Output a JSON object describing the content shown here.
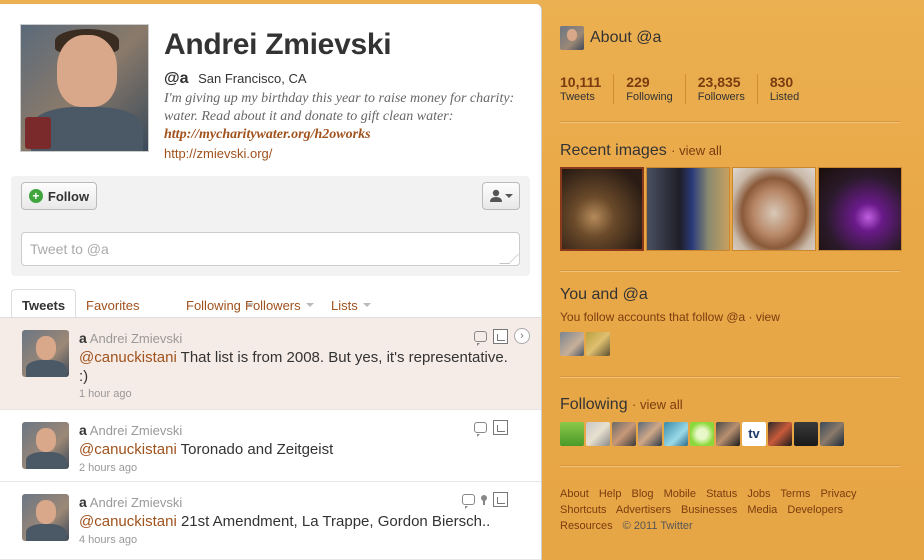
{
  "profile": {
    "name": "Andrei Zmievski",
    "handle": "@a",
    "location": "San Francisco, CA",
    "bio_text": "I'm giving up my birthday this year to raise money for charity: water. Read about it and donate to gift clean water: ",
    "bio_link": "http://mycharitywater.org/h2oworks",
    "website": "http://zmievski.org/"
  },
  "actions": {
    "follow_label": "Follow",
    "tweet_placeholder": "Tweet to @a"
  },
  "tabs": [
    {
      "label": "Tweets"
    },
    {
      "label": "Favorites"
    },
    {
      "label": "Following"
    },
    {
      "label": "Followers"
    },
    {
      "label": "Lists"
    }
  ],
  "tweets": [
    {
      "handle": "a",
      "name": "Andrei Zmievski",
      "mention": "@canuckistani",
      "text": " That list is from 2008. But yes, it's representative. :)",
      "time": "1 hour ago"
    },
    {
      "handle": "a",
      "name": "Andrei Zmievski",
      "mention": "@canuckistani",
      "text": " Toronado and Zeitgeist",
      "time": "2 hours ago"
    },
    {
      "handle": "a",
      "name": "Andrei Zmievski",
      "mention": "@canuckistani",
      "text": " 21st Amendment, La Trappe, Gordon Biersch..",
      "time": "4 hours ago"
    }
  ],
  "dashboard": {
    "about_title": "About @a",
    "stats": [
      {
        "num": "10,111",
        "label": "Tweets"
      },
      {
        "num": "229",
        "label": "Following"
      },
      {
        "num": "23,835",
        "label": "Followers"
      },
      {
        "num": "830",
        "label": "Listed"
      }
    ],
    "recent_images_title": "Recent images",
    "view_all": "view all",
    "you_and_title": "You and @a",
    "you_follow_text": "You follow accounts that follow @a",
    "view": "view",
    "following_title": "Following",
    "footer_links": [
      "About",
      "Help",
      "Blog",
      "Mobile",
      "Status",
      "Jobs",
      "Terms",
      "Privacy",
      "Shortcuts",
      "Advertisers",
      "Businesses",
      "Media",
      "Developers",
      "Resources"
    ],
    "copyright": "© 2011 Twitter"
  },
  "colors": {
    "background": "#e8a849",
    "link": "#a0521d",
    "dash_link": "#7a3c0f"
  }
}
